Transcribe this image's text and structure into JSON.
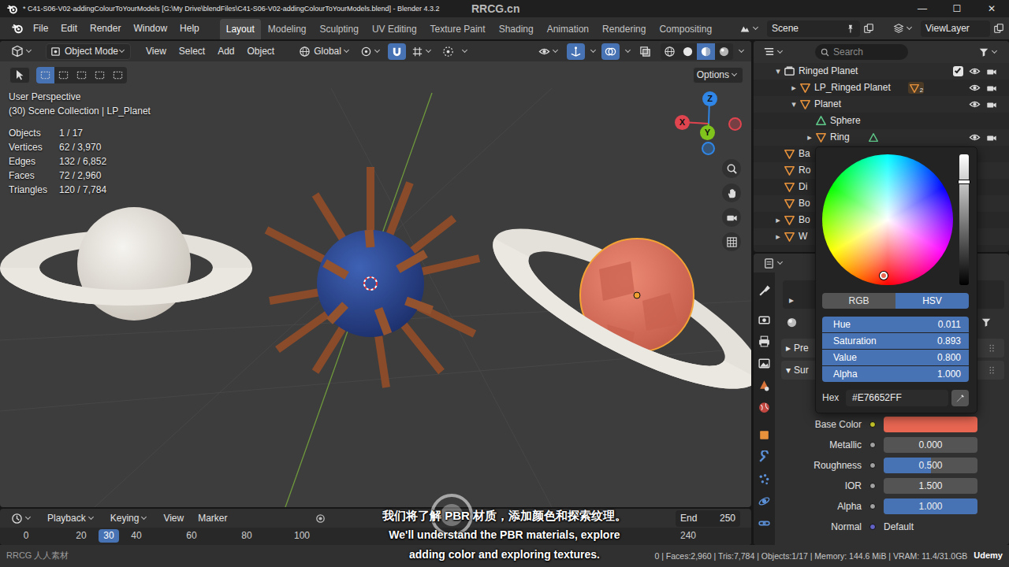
{
  "window": {
    "title": "* C41-S06-V02-addingColourToYourModels [G:\\My Drive\\blendFiles\\C41-S06-V02-addingColourToYourModels.blend] - Blender 4.3.2",
    "controls": [
      "—",
      "☐",
      "✕"
    ]
  },
  "watermarks": {
    "top": "RRCG.cn",
    "bottom": "RRCG 人人素材",
    "brand": "Udemy"
  },
  "menus": [
    "File",
    "Edit",
    "Render",
    "Window",
    "Help"
  ],
  "workspaces": [
    {
      "label": "Layout",
      "selected": true
    },
    {
      "label": "Modeling",
      "selected": false
    },
    {
      "label": "Sculpting",
      "selected": false
    },
    {
      "label": "UV Editing",
      "selected": false
    },
    {
      "label": "Texture Paint",
      "selected": false
    },
    {
      "label": "Shading",
      "selected": false
    },
    {
      "label": "Animation",
      "selected": false
    },
    {
      "label": "Rendering",
      "selected": false
    },
    {
      "label": "Compositing",
      "selected": false
    }
  ],
  "scene": "Scene",
  "view_layer": "ViewLayer",
  "viewport": {
    "mode": "Object Mode",
    "menus": [
      "View",
      "Select",
      "Add",
      "Object"
    ],
    "orientation": "Global",
    "toggles": [
      {
        "kind": "snap",
        "on": true
      },
      {
        "kind": "proportional",
        "on": false
      },
      {
        "kind": "gizmo",
        "on": true
      },
      {
        "kind": "overlay",
        "on": true
      },
      {
        "kind": "xray",
        "on": false
      }
    ],
    "shading": [
      {
        "kind": "wireframe",
        "selected": false
      },
      {
        "kind": "solid",
        "selected": false
      },
      {
        "kind": "material",
        "selected": true
      },
      {
        "kind": "rendered",
        "selected": false
      }
    ],
    "select_modes": [
      {
        "selected": true
      },
      {
        "selected": false
      },
      {
        "selected": false
      },
      {
        "selected": false
      },
      {
        "selected": false
      }
    ],
    "options": "Options",
    "view_name": "User Perspective",
    "collection": "(30) Scene Collection | LP_Planet",
    "stats": [
      {
        "label": "Objects",
        "value": "1 / 17"
      },
      {
        "label": "Vertices",
        "value": "62 / 3,970"
      },
      {
        "label": "Edges",
        "value": "132 / 6,852"
      },
      {
        "label": "Faces",
        "value": "72 / 2,960"
      },
      {
        "label": "Triangles",
        "value": "120 / 7,784"
      }
    ],
    "axes": [
      "X",
      "Y",
      "Z"
    ]
  },
  "outliner": {
    "search": {
      "placeholder": "Search"
    },
    "rows": [
      {
        "label": "Ringed Planet",
        "kind": "collection",
        "depth": 0,
        "arrow": "▾",
        "expanded": true,
        "checked": true,
        "visible": true,
        "renderable": true
      },
      {
        "label": "LP_Ringed Planet",
        "kind": "object",
        "depth": 1,
        "arrow": "▸",
        "expanded": false,
        "child_icon": "object",
        "child_count": "2",
        "visible": true,
        "renderable": true
      },
      {
        "label": "Planet",
        "kind": "object",
        "depth": 1,
        "arrow": "▾",
        "expanded": true,
        "visible": true,
        "renderable": true
      },
      {
        "label": "Sphere",
        "kind": "mesh",
        "depth": 2
      },
      {
        "label": "Ring",
        "kind": "object",
        "depth": 2,
        "arrow": "▸",
        "expanded": false,
        "child_icon": "mesh",
        "child_count": "",
        "visible": true,
        "renderable": true
      },
      {
        "label": "Ba",
        "kind": "object",
        "depth": 0
      },
      {
        "label": "Ro",
        "kind": "object",
        "depth": 0
      },
      {
        "label": "Di",
        "kind": "object",
        "depth": 0
      },
      {
        "label": "Bo",
        "kind": "object",
        "depth": 0
      },
      {
        "label": "Bo",
        "kind": "object",
        "depth": 0,
        "arrow": "▸",
        "expanded": false
      },
      {
        "label": "W",
        "kind": "object",
        "depth": 0,
        "arrow": "▸",
        "expanded": false
      }
    ]
  },
  "properties": {
    "tabs": [
      {
        "kind": "tool"
      },
      {
        "kind": "render"
      },
      {
        "kind": "output"
      },
      {
        "kind": "view_layer"
      },
      {
        "kind": "scene"
      },
      {
        "kind": "world"
      },
      {
        "kind": "object"
      },
      {
        "kind": "modifier"
      },
      {
        "kind": "particles"
      },
      {
        "kind": "physics"
      },
      {
        "kind": "constraints"
      }
    ],
    "slot_arrow": "▸",
    "panels": [
      {
        "arrow": "▸",
        "label": "Pre",
        "expanded": false
      },
      {
        "arrow": "▾",
        "label": "Sur",
        "expanded": true
      }
    ],
    "fields": [
      {
        "label": "Base Color",
        "kind": "color",
        "color": "#E76652"
      },
      {
        "label": "Metallic",
        "kind": "slider",
        "value": "0.000",
        "level": 0
      },
      {
        "label": "Roughness",
        "kind": "slider",
        "value": "0.500",
        "level": 0.5
      },
      {
        "label": "IOR",
        "kind": "number",
        "value": "1.500"
      },
      {
        "label": "Alpha",
        "kind": "slider",
        "value": "1.000",
        "level": 1
      },
      {
        "label": "Normal",
        "kind": "link",
        "value": "Default"
      }
    ]
  },
  "color_picker": {
    "modes": [
      {
        "label": "RGB",
        "selected": false
      },
      {
        "label": "HSV",
        "selected": true
      }
    ],
    "fields": [
      {
        "label": "Hue",
        "value": "0.011"
      },
      {
        "label": "Saturation",
        "value": "0.893"
      },
      {
        "label": "Value",
        "value": "0.800"
      },
      {
        "label": "Alpha",
        "value": "1.000"
      }
    ],
    "hex_label": "Hex",
    "hex": "#E76652FF",
    "color": "#E76652"
  },
  "timeline": {
    "menus": [
      {
        "label": "Playback",
        "kind": "dropdown"
      },
      {
        "label": "Keying",
        "kind": "dropdown"
      },
      {
        "label": "View",
        "kind": "plain"
      },
      {
        "label": "Marker",
        "kind": "plain"
      }
    ],
    "frames": [
      "0",
      "20",
      "40",
      "60",
      "80",
      "100",
      "240"
    ],
    "current": "30",
    "end_label": "End",
    "end": "250"
  },
  "status_bar": "0 | Faces:2,960 | Tris:7,784 | Objects:1/17 | Memory: 144.6 MiB | VRAM: 11.4/31.0GB",
  "subtitles": [
    "我们将了解 PBR 材质，添加颜色和探索纹理。",
    "We'll understand the PBR materials, explore",
    "adding color and exploring textures."
  ]
}
